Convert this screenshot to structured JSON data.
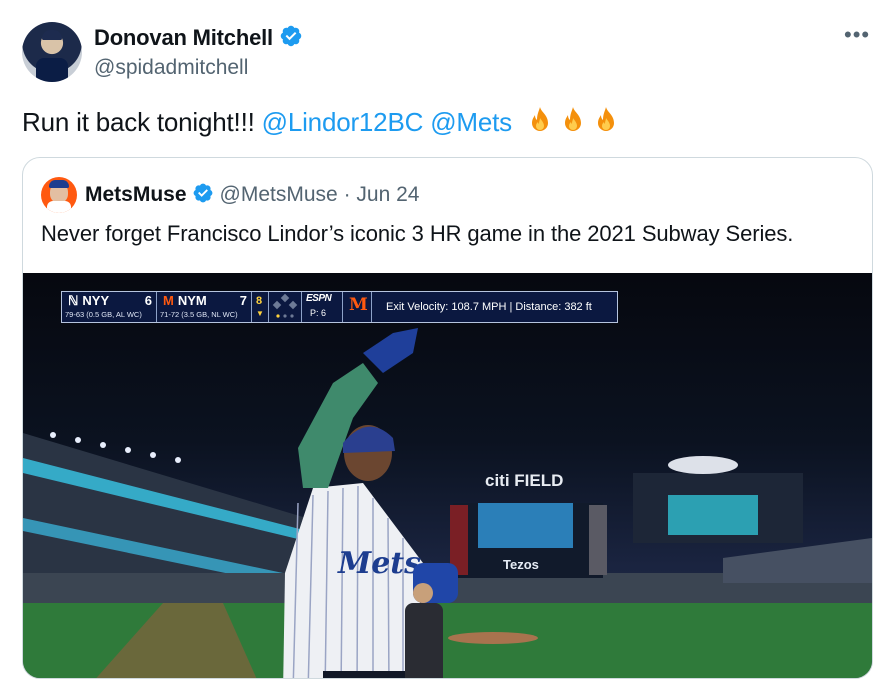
{
  "tweet": {
    "author_name": "Donovan Mitchell",
    "author_handle": "@spidadmitchell",
    "more_label": "•••",
    "text_prefix": "Run it back tonight!!!",
    "mentions": [
      "@Lindor12BC",
      "@Mets"
    ],
    "emoji": [
      "fire",
      "fire",
      "fire"
    ]
  },
  "quote": {
    "author_name": "MetsMuse",
    "author_handle": "@MetsMuse",
    "separator": "·",
    "date": "Jun 24",
    "text": "Never forget Francisco Lindor’s iconic 3 HR game in the 2021 Subway Series."
  },
  "scorebug": {
    "away_team": "NYY",
    "away_score": "6",
    "away_record": "79-63 (0.5 GB, AL WC)",
    "home_team": "NYM",
    "home_score": "7",
    "home_record": "71-72 (3.5 GB, NL WC)",
    "inning": "8",
    "network": "ESPN",
    "pitch_count": "P: 6",
    "exit_info": "Exit Velocity: 108.7 MPH  |  Distance: 382 ft"
  },
  "media": {
    "stadium_sign": "citi FIELD",
    "scoreboard_sign": "Tezos",
    "jersey_text": "Mets"
  },
  "colors": {
    "accent": "#1d9bf0",
    "mets_orange": "#ff5910",
    "mets_blue": "#002d72",
    "verified": "#1d9bf0"
  }
}
